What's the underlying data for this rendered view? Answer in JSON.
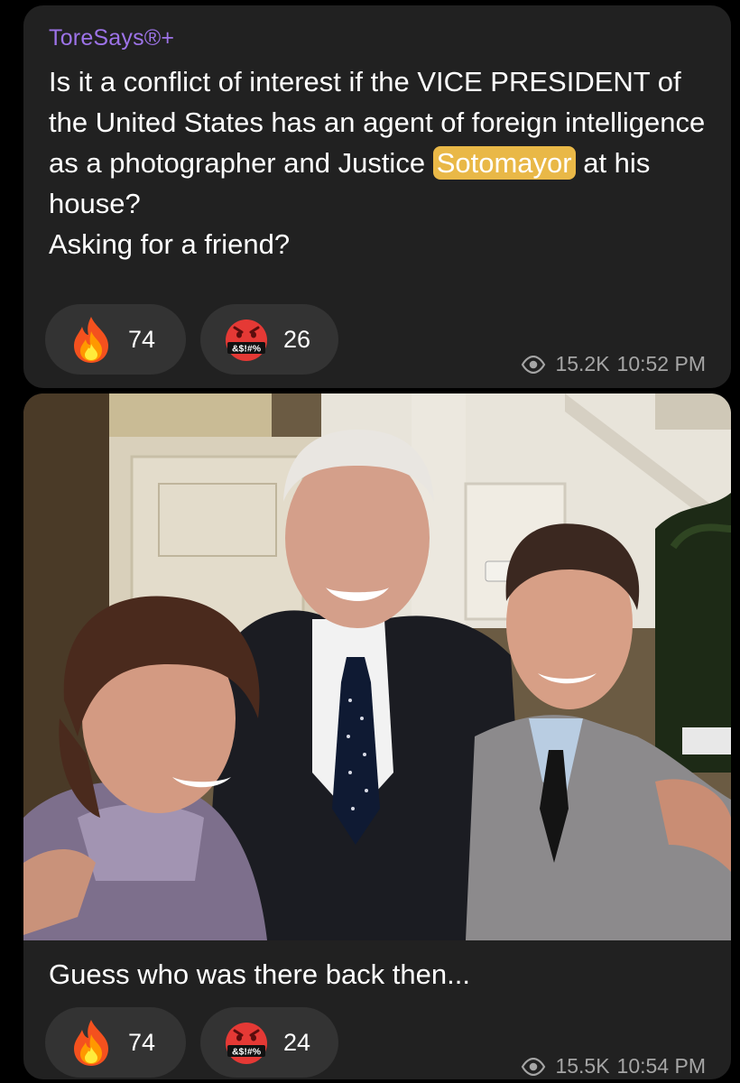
{
  "message1": {
    "author": "ToreSays®+",
    "text_before": "Is it a conflict of interest if the VICE PRESIDENT of the United States has an agent of foreign intelligence as a photographer and Justice",
    "highlight": "Sotomayor",
    "text_after": "at his house?",
    "text_line2": "Asking for a friend?",
    "reactions": [
      {
        "icon": "fire-icon",
        "count": "74"
      },
      {
        "icon": "cursing-face-icon",
        "count": "26"
      }
    ],
    "views": "15.2K",
    "time": "10:52 PM"
  },
  "message2": {
    "photo": "photo-three-people-posing",
    "caption": "Guess who was there back then...",
    "reactions": [
      {
        "icon": "fire-icon",
        "count": "74"
      },
      {
        "icon": "cursing-face-icon",
        "count": "24"
      }
    ],
    "views": "15.5K",
    "time": "10:54 PM"
  },
  "colors": {
    "background": "#000000",
    "bubble": "#212121",
    "author": "#9d73e8",
    "highlight": "#e9b847",
    "reaction_pill": "#333333",
    "meta_text": "#a5a5a5"
  }
}
